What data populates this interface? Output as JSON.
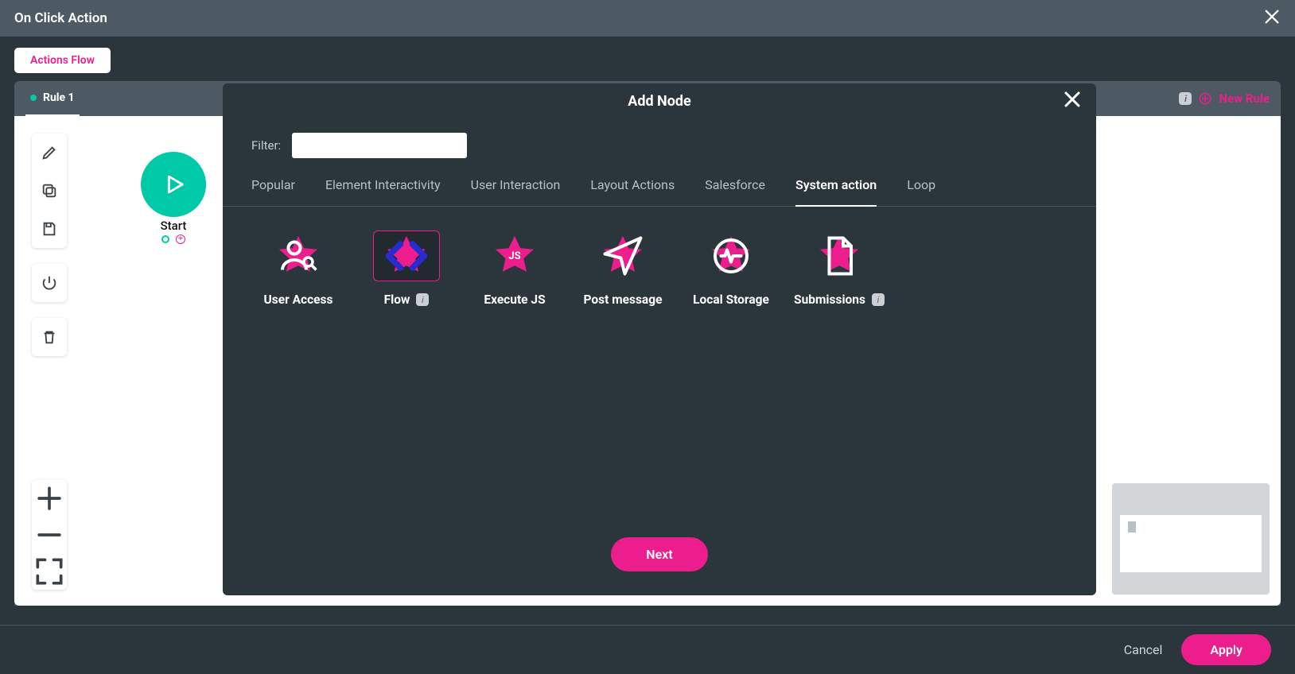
{
  "titlebar": {
    "title": "On Click Action"
  },
  "buttons": {
    "actions_flow": "Actions Flow",
    "new_rule": "New Rule",
    "next": "Next",
    "cancel": "Cancel",
    "apply": "Apply"
  },
  "tabs": {
    "rule1": "Rule 1"
  },
  "canvas": {
    "start_label": "Start"
  },
  "modal": {
    "title": "Add Node",
    "filter_label": "Filter:",
    "filter_value": "",
    "categories": {
      "popular": "Popular",
      "element_interactivity": "Element Interactivity",
      "user_interaction": "User Interaction",
      "layout_actions": "Layout Actions",
      "salesforce": "Salesforce",
      "system_action": "System action",
      "loop": "Loop"
    },
    "active_category": "system_action",
    "nodes": {
      "user_access": "User Access",
      "flow": "Flow",
      "execute_js": "Execute JS",
      "post_message": "Post message",
      "local_storage": "Local Storage",
      "submissions": "Submissions"
    },
    "selected_node": "flow"
  }
}
